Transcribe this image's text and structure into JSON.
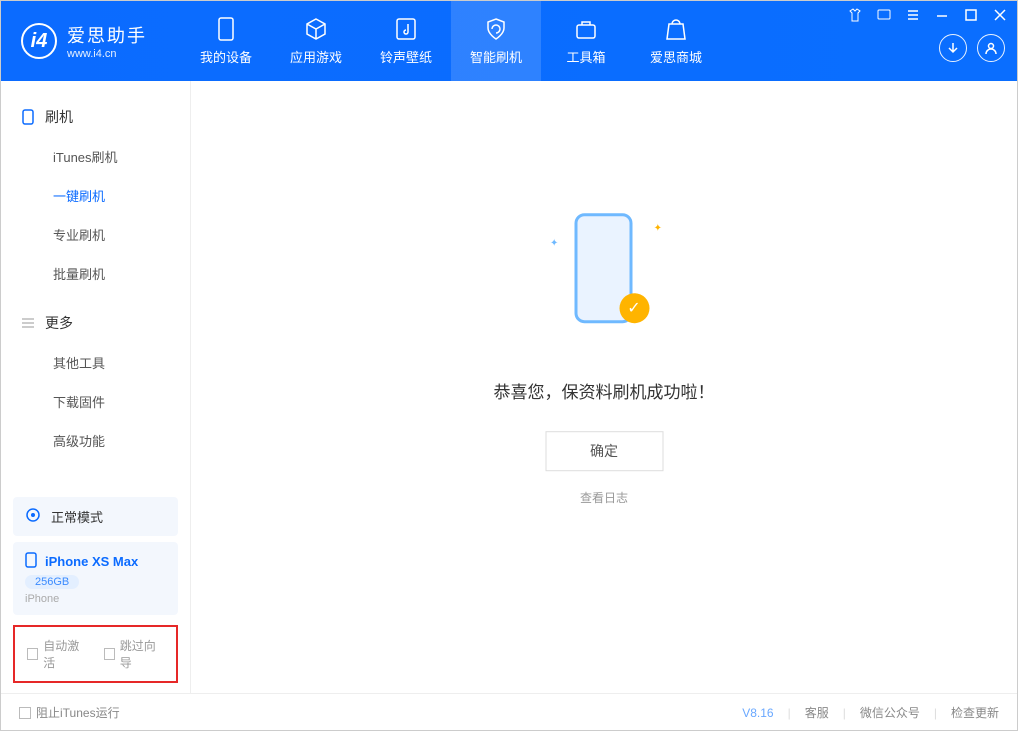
{
  "app": {
    "name": "爱思助手",
    "url": "www.i4.cn"
  },
  "nav": {
    "items": [
      {
        "label": "我的设备"
      },
      {
        "label": "应用游戏"
      },
      {
        "label": "铃声壁纸"
      },
      {
        "label": "智能刷机"
      },
      {
        "label": "工具箱"
      },
      {
        "label": "爱思商城"
      }
    ],
    "selected": 3
  },
  "sidebar": {
    "section1": {
      "title": "刷机",
      "items": [
        "iTunes刷机",
        "一键刷机",
        "专业刷机",
        "批量刷机"
      ],
      "active": 1
    },
    "section2": {
      "title": "更多",
      "items": [
        "其他工具",
        "下载固件",
        "高级功能"
      ]
    }
  },
  "device": {
    "mode": "正常模式",
    "name": "iPhone XS Max",
    "storage": "256GB",
    "type": "iPhone"
  },
  "options": {
    "opt1": "自动激活",
    "opt2": "跳过向导"
  },
  "main": {
    "message": "恭喜您，保资料刷机成功啦！",
    "ok": "确定",
    "log": "查看日志"
  },
  "footer": {
    "block_itunes": "阻止iTunes运行",
    "version": "V8.16",
    "links": [
      "客服",
      "微信公众号",
      "检查更新"
    ]
  }
}
